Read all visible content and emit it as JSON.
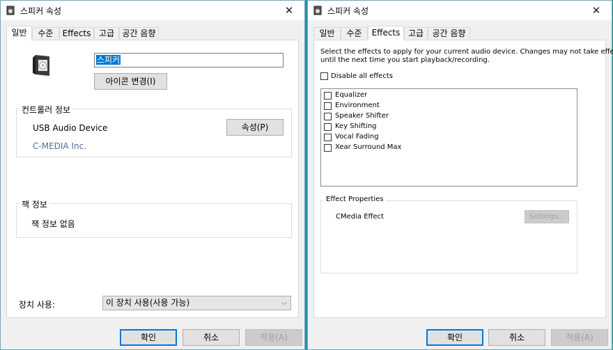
{
  "left": {
    "title": "스피커 속성",
    "close": "✕",
    "tabs": [
      "일반",
      "수준",
      "Effects",
      "고급",
      "공간 음향"
    ],
    "device_name": "스피커",
    "change_icon_button": "아이콘 변경(I)",
    "controller": {
      "label": "컨트롤러 정보",
      "device": "USB Audio Device",
      "vendor": "C-MEDIA Inc.",
      "properties_button": "속성(P)"
    },
    "jack": {
      "label": "잭 정보",
      "value": "잭 정보 없음"
    },
    "device_usage": {
      "label": "장치 사용:",
      "selected": "이 장치 사용(사용 가능)"
    },
    "buttons": {
      "ok": "확인",
      "cancel": "취소",
      "apply": "적용(A)"
    }
  },
  "right": {
    "title": "스피커 속성",
    "close": "✕",
    "tabs": [
      "일반",
      "수준",
      "Effects",
      "고급",
      "공간 음향"
    ],
    "description_line1": "Select the effects to apply for your current audio device. Changes may not take effect",
    "description_line2": "until the next time you start playback/recording.",
    "disable_all": "Disable all effects",
    "effects": [
      "Equalizer",
      "Environment",
      "Speaker Shifter",
      "Key Shifting",
      "Vocal Fading",
      "Xear Surround Max"
    ],
    "effect_properties": {
      "label": "Effect Properties",
      "name": "CMedia Effect",
      "settings_button": "Settings..."
    },
    "buttons": {
      "ok": "확인",
      "cancel": "취소",
      "apply": "적용(A)"
    }
  },
  "colors": {
    "accent": "#0078d7",
    "vendor_link": "#4a6fa0",
    "desktop": "#2a8fa3"
  }
}
